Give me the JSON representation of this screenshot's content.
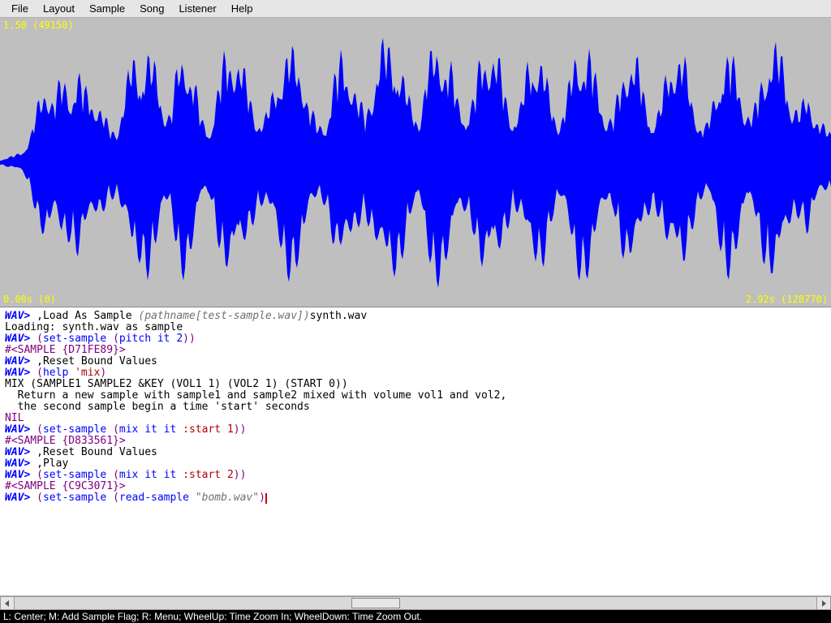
{
  "menubar": {
    "items": [
      "File",
      "Layout",
      "Sample",
      "Song",
      "Listener",
      "Help"
    ]
  },
  "waveform": {
    "top_left_label": "1.50 (49150)",
    "bottom_left_label": "0.00s (0)",
    "bottom_right_label": "2.92s (128770)"
  },
  "listener": {
    "lines": [
      [
        {
          "cls": "wavprompt",
          "t": "WAV> "
        },
        {
          "cls": "",
          "t": ",Load As Sample "
        },
        {
          "cls": "clr-grey",
          "t": "(pathname[test-sample.wav])"
        },
        {
          "cls": "",
          "t": "synth.wav"
        }
      ],
      [
        {
          "cls": "",
          "t": "Loading: synth.wav as sample"
        }
      ],
      [
        {
          "cls": "wavprompt",
          "t": "WAV> "
        },
        {
          "cls": "clr-purple",
          "t": "("
        },
        {
          "cls": "clr-blue",
          "t": "set-sample "
        },
        {
          "cls": "clr-purple",
          "t": "("
        },
        {
          "cls": "clr-blue",
          "t": "pitch it 2"
        },
        {
          "cls": "clr-purple",
          "t": ")"
        },
        {
          "cls": "clr-purple",
          "t": ")"
        }
      ],
      [
        {
          "cls": "clr-dpurp",
          "t": "#<SAMPLE {D71FE89}>"
        }
      ],
      [
        {
          "cls": "wavprompt",
          "t": "WAV> "
        },
        {
          "cls": "",
          "t": ",Reset Bound Values"
        }
      ],
      [
        {
          "cls": "wavprompt",
          "t": "WAV> "
        },
        {
          "cls": "clr-purple",
          "t": "("
        },
        {
          "cls": "clr-blue",
          "t": "help "
        },
        {
          "cls": "clr-dred",
          "t": "'mix"
        },
        {
          "cls": "clr-purple",
          "t": ")"
        }
      ],
      [
        {
          "cls": "",
          "t": "MIX (SAMPLE1 SAMPLE2 &KEY (VOL1 1) (VOL2 1) (START 0))"
        }
      ],
      [
        {
          "cls": "",
          "t": "  Return a new sample with sample1 and sample2 mixed with volume vol1 and vol2,"
        }
      ],
      [
        {
          "cls": "",
          "t": "  the second sample begin a time 'start' seconds"
        }
      ],
      [
        {
          "cls": "clr-dpurp",
          "t": "NIL"
        }
      ],
      [
        {
          "cls": "wavprompt",
          "t": "WAV> "
        },
        {
          "cls": "clr-purple",
          "t": "("
        },
        {
          "cls": "clr-blue",
          "t": "set-sample "
        },
        {
          "cls": "clr-purple",
          "t": "("
        },
        {
          "cls": "clr-blue",
          "t": "mix it it "
        },
        {
          "cls": "clr-dred",
          "t": ":start 1"
        },
        {
          "cls": "clr-purple",
          "t": ")"
        },
        {
          "cls": "clr-purple",
          "t": ")"
        }
      ],
      [
        {
          "cls": "clr-dpurp",
          "t": "#<SAMPLE {D833561}>"
        }
      ],
      [
        {
          "cls": "wavprompt",
          "t": "WAV> "
        },
        {
          "cls": "",
          "t": ",Reset Bound Values"
        }
      ],
      [
        {
          "cls": "wavprompt",
          "t": "WAV> "
        },
        {
          "cls": "",
          "t": ",Play"
        }
      ],
      [
        {
          "cls": "wavprompt",
          "t": "WAV> "
        },
        {
          "cls": "clr-purple",
          "t": "("
        },
        {
          "cls": "clr-blue",
          "t": "set-sample "
        },
        {
          "cls": "clr-purple",
          "t": "("
        },
        {
          "cls": "clr-blue",
          "t": "mix it it "
        },
        {
          "cls": "clr-dred",
          "t": ":start 2"
        },
        {
          "cls": "clr-purple",
          "t": ")"
        },
        {
          "cls": "clr-purple",
          "t": ")"
        }
      ],
      [
        {
          "cls": "clr-dpurp",
          "t": "#<SAMPLE {C9C3071}>"
        }
      ],
      [
        {
          "cls": "wavprompt",
          "t": "WAV> "
        },
        {
          "cls": "clr-purple",
          "t": "("
        },
        {
          "cls": "clr-blue",
          "t": "set-sample "
        },
        {
          "cls": "clr-purple",
          "t": "("
        },
        {
          "cls": "clr-blue",
          "t": "read-sample "
        },
        {
          "cls": "clr-grey",
          "t": "\"bomb.wav\""
        },
        {
          "cls": "clr-purple",
          "t": ")"
        },
        {
          "cls": "cursor",
          "t": ""
        }
      ]
    ]
  },
  "statusbar": {
    "text": "L: Center; M: Add Sample Flag; R: Menu; WheelUp: Time Zoom In; WheelDown: Time Zoom Out."
  },
  "colors": {
    "waveform": "#0000ff",
    "overlay_text": "#ffff00",
    "panel_bg": "#bfbfbf"
  }
}
